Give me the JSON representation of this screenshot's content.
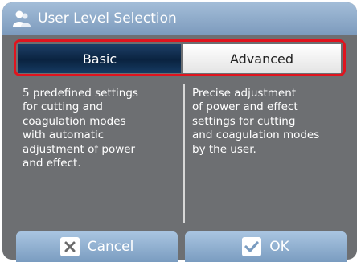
{
  "dialog": {
    "title": "User Level Selection",
    "title_icon": "user-icon"
  },
  "tabs": [
    {
      "label": "Basic",
      "selected": true
    },
    {
      "label": "Advanced",
      "selected": false
    }
  ],
  "descriptions": {
    "basic": "5 predefined settings\nfor cutting and\ncoagulation modes\nwith automatic\nadjustment of power\nand effect.",
    "advanced": "Precise adjustment\nof power and effect\nsettings for cutting\nand coagulation modes\nby the user."
  },
  "buttons": {
    "cancel": {
      "label": "Cancel",
      "icon": "x-icon"
    },
    "ok": {
      "label": "OK",
      "icon": "checkmark-icon"
    }
  },
  "colors": {
    "highlight_outline": "#e0141e",
    "selected_tab": "#0a2340",
    "titlebar": "#8eaccd"
  }
}
